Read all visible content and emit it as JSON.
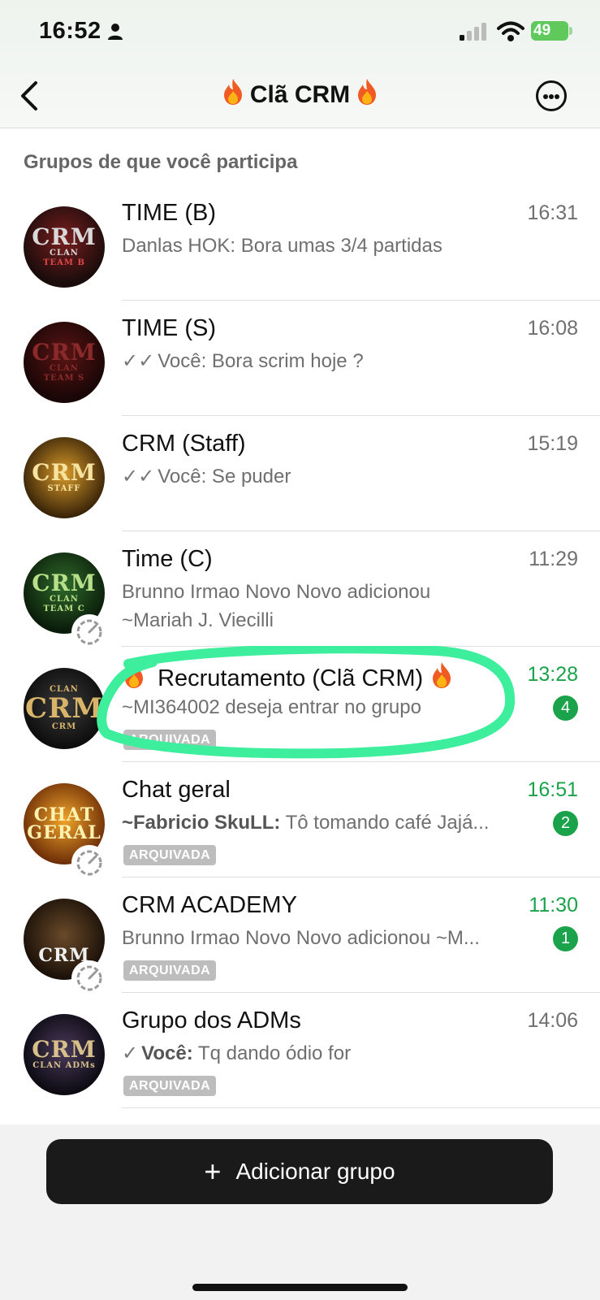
{
  "status_bar": {
    "time": "16:52",
    "battery": "49",
    "icons": [
      "person-icon",
      "signal-icon",
      "wifi-icon",
      "battery-icon"
    ]
  },
  "nav": {
    "title": "Clã CRM",
    "back_icon": "chevron-left-icon",
    "more_icon": "ellipsis-circle-icon"
  },
  "section": {
    "title": "Grupos de que você participa"
  },
  "groups": [
    {
      "title": "TIME (B)",
      "time": "16:31",
      "sender": "Danlas HOK:",
      "message": " Bora umas 3/4 partidas",
      "avatar_big": "CRM",
      "avatar_small": "CLAN",
      "avatar_sub": "TEAM B"
    },
    {
      "title": "TIME (S)",
      "time": "16:08",
      "ticks": "✓✓",
      "sender": "Você:",
      "message": " Bora scrim hoje ?",
      "avatar_big": "CRM",
      "avatar_small": "CLAN",
      "avatar_sub": "TEAM S"
    },
    {
      "title": "CRM (Staff)",
      "time": "15:19",
      "ticks": "✓✓",
      "sender": "Você:",
      "message": " Se puder",
      "avatar_big": "CRM",
      "avatar_small": "STAFF",
      "avatar_sub": ""
    },
    {
      "title": "Time (C)",
      "time": "11:29",
      "line1": "Brunno Irmao Novo Novo adicionou",
      "line2": "~Mariah J. Viecilli",
      "avatar_big": "CRM",
      "avatar_small": "CLAN",
      "avatar_sub": "TEAM C"
    },
    {
      "title": "Recrutamento (Clã CRM)",
      "time": "13:28",
      "line1": "~MI364002 deseja entrar no grupo",
      "unread": "4",
      "archived": "ARQUIVADA",
      "avatar_big": "CRM",
      "avatar_small": "CLAN",
      "avatar_sub": "CRM"
    },
    {
      "title": "Chat geral",
      "time": "16:51",
      "sender": "~Fabricio SkuLL:",
      "message": " Tô tomando café Jajá...",
      "unread": "2",
      "archived": "ARQUIVADA",
      "avatar_big": "CHAT",
      "avatar_small": "GERAL",
      "avatar_sub": ""
    },
    {
      "title": "CRM ACADEMY",
      "time": "11:30",
      "line1": "Brunno Irmao Novo Novo adicionou ~M...",
      "unread": "1",
      "archived": "ARQUIVADA",
      "avatar_big": "CRM",
      "avatar_small": "",
      "avatar_sub": ""
    },
    {
      "title": "Grupo dos ADMs",
      "time": "14:06",
      "ticks": "✓",
      "sender": "Você:",
      "message": " Tq dando ódio for",
      "archived": "ARQUIVADA",
      "avatar_big": "CRM",
      "avatar_small": "CLAN ADMs",
      "avatar_sub": ""
    }
  ],
  "footer": {
    "add_label": "Adicionar grupo",
    "add_icon": "plus-icon"
  },
  "colors": {
    "unread_green": "#1aa34a",
    "highlight_ring": "#3dee9c",
    "button_dark": "#1a1a1a"
  }
}
